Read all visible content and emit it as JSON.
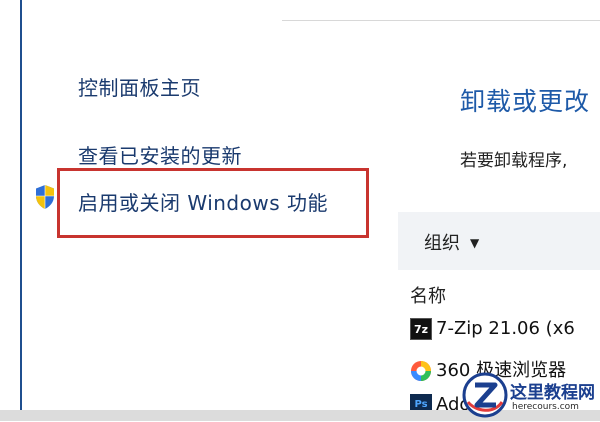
{
  "sidebar": {
    "links": [
      {
        "label": "控制面板主页"
      },
      {
        "label": "查看已安装的更新"
      },
      {
        "label": "启用或关闭 Windows 功能",
        "icon": "uac-shield-icon"
      }
    ]
  },
  "main": {
    "title": "卸载或更改",
    "description": "若要卸载程序,",
    "toolbar": {
      "organize_label": "组织"
    },
    "column_header": "名称",
    "programs": [
      {
        "name": "7-Zip 21.06 (x6",
        "icon_text": "7z",
        "icon": "7zip-icon"
      },
      {
        "name": "360 极速浏览器",
        "icon": "360-browser-icon"
      },
      {
        "name": "Adobe",
        "icon_text": "Ps",
        "icon": "photoshop-icon"
      }
    ]
  },
  "watermark": {
    "title": "这里教程网",
    "subtitle": "herecours.com"
  },
  "colors": {
    "highlight": "#c8342f",
    "link": "#1a3a6e",
    "title": "#1e5aa8",
    "toolbar_bg": "#f1f3f6"
  }
}
